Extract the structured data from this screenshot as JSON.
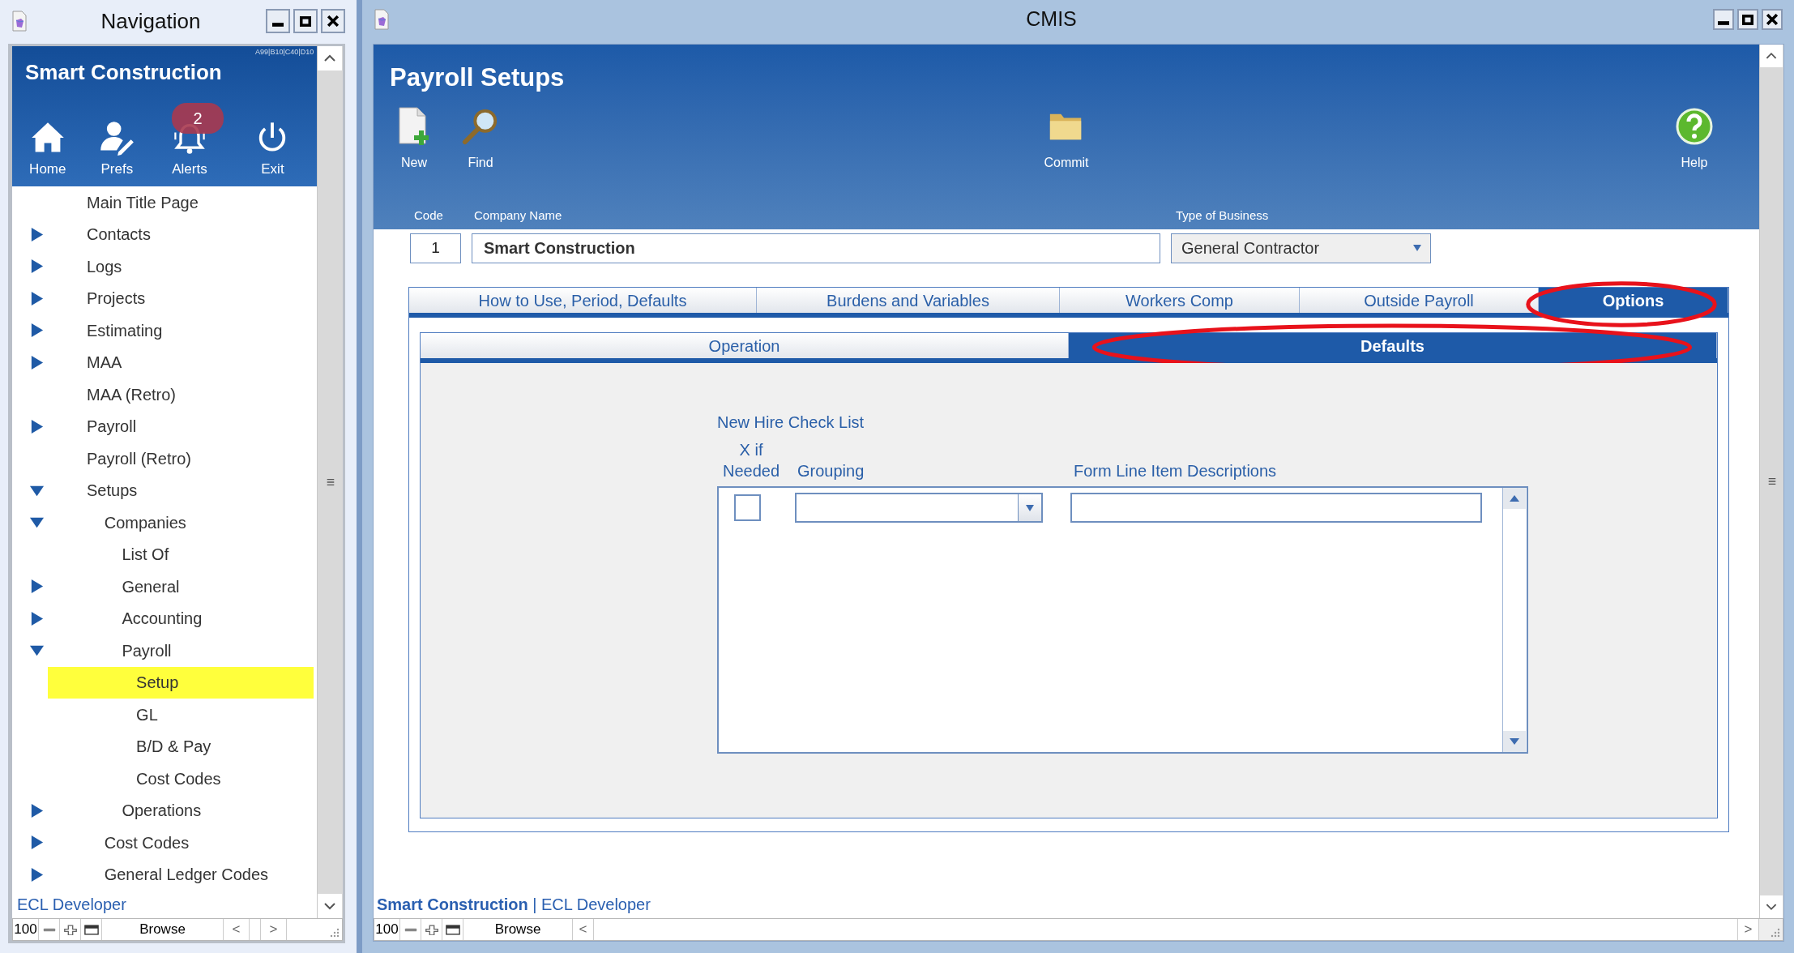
{
  "navigation": {
    "title": "Navigation",
    "company": "Smart Construction",
    "code": "A99|B10|C40|D10",
    "toolbar": [
      {
        "kind": "home",
        "label": "Home"
      },
      {
        "kind": "prefs",
        "label": "Prefs"
      },
      {
        "kind": "alerts",
        "label": "Alerts",
        "badge": "2"
      },
      {
        "kind": "exit",
        "label": "Exit"
      }
    ],
    "tree": [
      {
        "label": "Main Title Page",
        "selected": false
      },
      {
        "label": "Contacts",
        "expanded": false,
        "selected": false
      },
      {
        "label": "Logs",
        "expanded": false,
        "selected": false
      },
      {
        "label": "Projects",
        "expanded": false,
        "selected": false
      },
      {
        "label": "Estimating",
        "expanded": false,
        "selected": false
      },
      {
        "label": "MAA",
        "expanded": false,
        "selected": false
      },
      {
        "label": "MAA (Retro)",
        "selected": false
      },
      {
        "label": "Payroll",
        "expanded": false,
        "selected": false
      },
      {
        "label": "Payroll (Retro)",
        "selected": false
      },
      {
        "label": "Setups",
        "expanded": true,
        "selected": false,
        "children": [
          {
            "label": "Companies",
            "expanded": true,
            "selected": false,
            "children": [
              {
                "label": "List Of",
                "selected": false
              },
              {
                "label": "General",
                "expanded": false,
                "selected": false
              },
              {
                "label": "Accounting",
                "expanded": false,
                "selected": false
              },
              {
                "label": "Payroll",
                "expanded": true,
                "selected": false,
                "children": [
                  {
                    "label": "Setup",
                    "selected": true
                  },
                  {
                    "label": "GL",
                    "selected": false
                  },
                  {
                    "label": "B/D & Pay",
                    "selected": false
                  },
                  {
                    "label": "Cost Codes",
                    "selected": false
                  }
                ]
              },
              {
                "label": "Operations",
                "expanded": false,
                "selected": false
              }
            ]
          },
          {
            "label": "Cost Codes",
            "expanded": false,
            "selected": false
          },
          {
            "label": "General Ledger Codes",
            "expanded": false,
            "selected": false
          }
        ]
      }
    ],
    "user": "ECL Developer",
    "status_bar": {
      "zoom": "100",
      "mode": "Browse",
      "prev": "<",
      "next": ">"
    }
  },
  "main": {
    "title": "CMIS",
    "heading": "Payroll Setups",
    "toolbar": [
      {
        "kind": "new",
        "label": "New"
      },
      {
        "kind": "find",
        "label": "Find"
      },
      {
        "kind": "commit",
        "label": "Commit"
      },
      {
        "kind": "help",
        "label": "Help"
      }
    ],
    "fields": {
      "code_label": "Code",
      "code": "1",
      "company_label": "Company Name",
      "company": "Smart Construction",
      "business_label": "Type of Business",
      "business": "General Contractor"
    },
    "tabs": [
      {
        "label": "How to Use, Period, Defaults",
        "selected": false,
        "circled": false
      },
      {
        "label": "Burdens and Variables",
        "selected": false,
        "circled": false
      },
      {
        "label": "Workers Comp",
        "selected": false,
        "circled": false
      },
      {
        "label": "Outside Payroll",
        "selected": false,
        "circled": false
      },
      {
        "label": "Options",
        "selected": true,
        "circled": true
      }
    ],
    "subtabs": [
      {
        "label": "Operation",
        "selected": false,
        "circled": false
      },
      {
        "label": "Defaults",
        "selected": true,
        "circled": true
      }
    ],
    "checklist": {
      "title": "New Hire Check List",
      "columns": [
        "X if Needed",
        "Grouping",
        "Form Line Item Descriptions"
      ],
      "rows": [
        {
          "checked": false
        }
      ]
    },
    "footer": "**Smart Construction** | ECL Developer",
    "status_bar": {
      "zoom": "100",
      "mode": "Browse",
      "prev": "<",
      "next": ">"
    }
  }
}
